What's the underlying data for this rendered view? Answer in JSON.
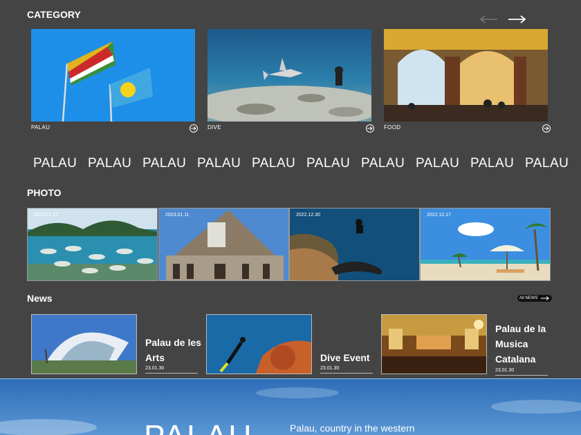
{
  "category": {
    "title": "CATEGORY",
    "items": [
      {
        "label": "PALAU"
      },
      {
        "label": "DIVE"
      },
      {
        "label": "FOOD"
      }
    ]
  },
  "marquee": {
    "words": [
      "PALAU",
      "PALAU",
      "PALAU",
      "PALAU",
      "PALAU",
      "PALAU",
      "PALAU",
      "PALAU",
      "PALAU",
      "PALAU"
    ]
  },
  "photo": {
    "title": "PHOTO",
    "items": [
      {
        "date": "2023.01.27"
      },
      {
        "date": "2023.01.11"
      },
      {
        "date": "2022.12.30"
      },
      {
        "date": "2022.12.17"
      }
    ]
  },
  "news": {
    "title": "News",
    "all_label": "All NEWS",
    "items": [
      {
        "title_line1": "Palau de les",
        "title_line2": "Arts",
        "title_line3": "",
        "date": "23.01.30"
      },
      {
        "title_line1": "Dive Event",
        "title_line2": "",
        "title_line3": "",
        "date": "23.01.30"
      },
      {
        "title_line1": "Palau de la",
        "title_line2": "Musica",
        "title_line3": "Catalana",
        "date": "23.01.30"
      }
    ]
  },
  "hero": {
    "big_text": "PALAU",
    "description": "Palau, country in the western"
  }
}
